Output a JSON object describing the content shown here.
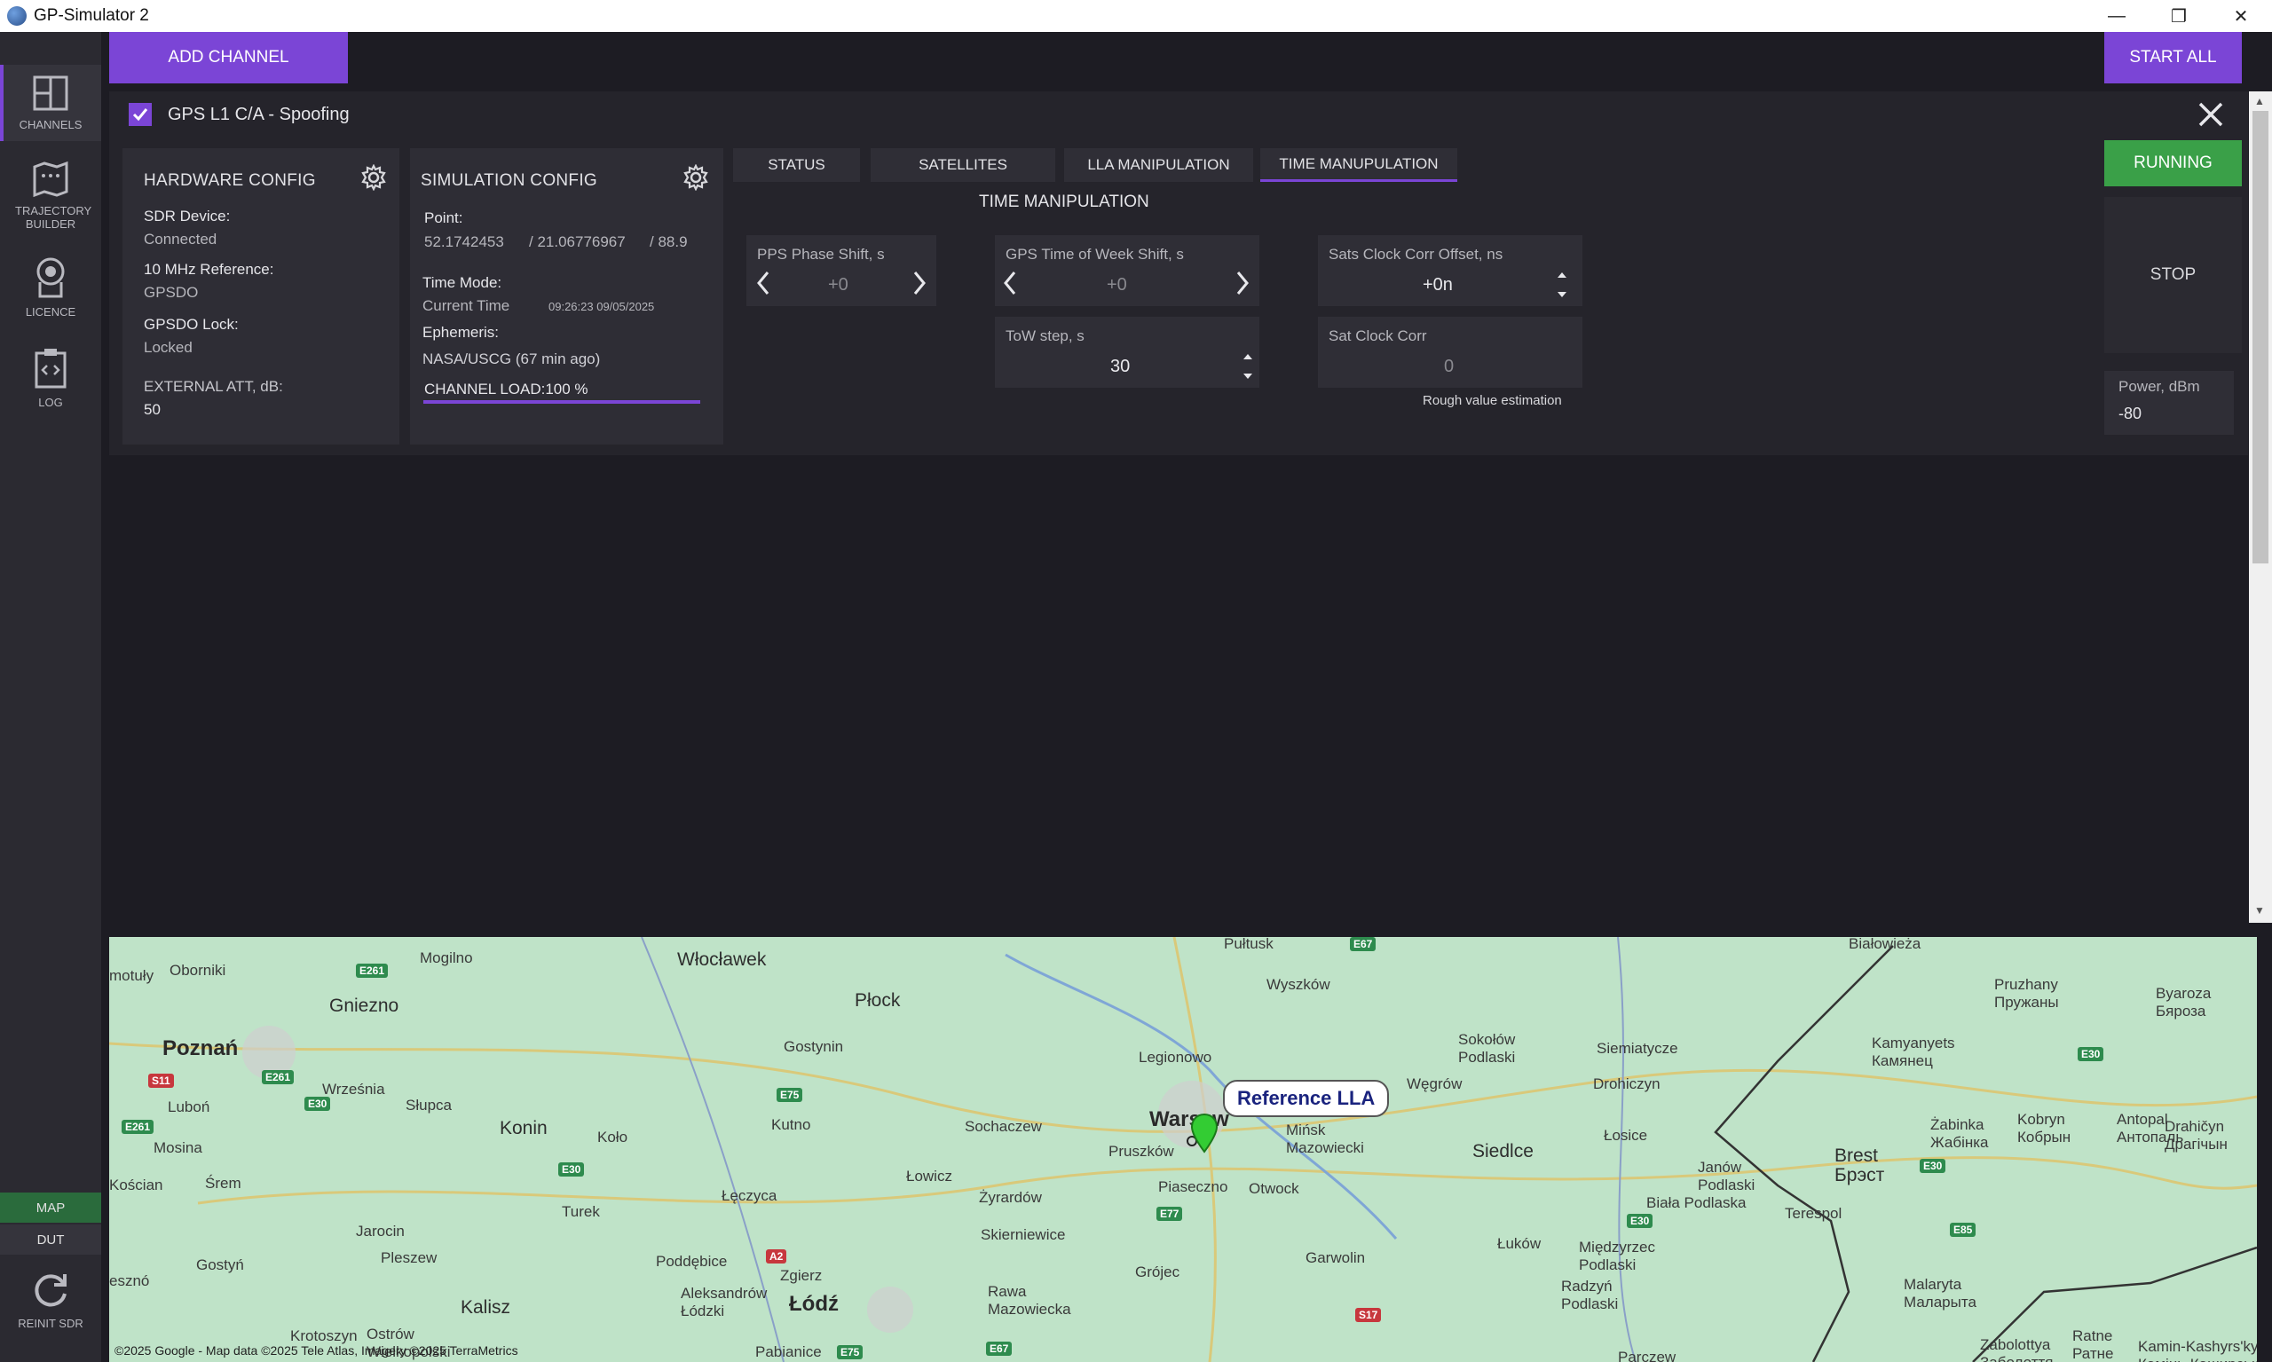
{
  "window": {
    "title": "GP-Simulator 2",
    "minimize": "—",
    "restore": "❐",
    "close": "✕"
  },
  "sidebar": {
    "items": [
      {
        "label": "CHANNELS",
        "icon": "grid-icon"
      },
      {
        "label": "TRAJECTORY BUILDER",
        "icon": "map-route-icon"
      },
      {
        "label": "LICENCE",
        "icon": "badge-icon"
      },
      {
        "label": "LOG",
        "icon": "code-clipboard-icon"
      }
    ],
    "map_label": "MAP",
    "dut_label": "DUT",
    "reinit_label": "REINIT SDR"
  },
  "toolbar": {
    "add_channel": "ADD CHANNEL",
    "start_all": "START ALL"
  },
  "channel": {
    "title": "GPS L1 C/A - Spoofing",
    "checked": true,
    "hardware": {
      "title": "HARDWARE CONFIG",
      "sdr_label": "SDR Device:",
      "sdr_value": "Connected",
      "ref_label": "10 MHz Reference:",
      "ref_value": "GPSDO",
      "lock_label": "GPSDO Lock:",
      "lock_value": "Locked",
      "att_label": "EXTERNAL ATT, dB:",
      "att_value": "50"
    },
    "simulation": {
      "title": "SIMULATION CONFIG",
      "point_label": "Point:",
      "lat": "52.1742453",
      "lon": "/ 21.06776967",
      "alt": "/ 88.9",
      "time_mode_label": "Time Mode:",
      "time_mode_value": "Current Time",
      "time_stamp": "09:26:23  09/05/2025",
      "ephemeris_label": "Ephemeris:",
      "ephemeris_value": "NASA/USCG (67 min ago)",
      "load_label": "CHANNEL LOAD:100  %",
      "load_fraction": 1.0
    },
    "tabs": [
      "STATUS",
      "SATELLITES",
      "LLA MANIPULATION",
      "TIME MANUPULATION"
    ],
    "active_tab": 3,
    "time_manipulation": {
      "heading": "TIME MANIPULATION",
      "pps_label": "PPS Phase Shift, s",
      "pps_value": "+0",
      "gps_tow_label": "GPS Time of Week Shift, s",
      "gps_tow_value": "+0",
      "sats_clock_label": "Sats Clock Corr Offset, ns",
      "sats_clock_value": "+0n",
      "tow_step_label": "ToW step, s",
      "tow_step_value": "30",
      "sat_clock_corr_label": "Sat Clock Corr",
      "sat_clock_corr_value": "0",
      "rough_note": "Rough value estimation"
    },
    "running_label": "RUNNING",
    "stop_label": "STOP",
    "power_label": "Power, dBm",
    "power_value": "-80"
  },
  "map": {
    "callout": "Reference LLA",
    "credits": "©2025 Google - Map data ©2025 Tele Atlas, Imagery ©2025 TerraMetrics",
    "cities": [
      {
        "name": "Poznań",
        "cls": "big"
      },
      {
        "name": "Warsaw",
        "cls": "big"
      },
      {
        "name": "Łódź",
        "cls": "big"
      },
      {
        "name": "Konin",
        "cls": "mid"
      },
      {
        "name": "Płock",
        "cls": "mid"
      },
      {
        "name": "Siedlce",
        "cls": "mid"
      },
      {
        "name": "Brest\nБрэст",
        "cls": "mid"
      },
      {
        "name": "Włocławek",
        "cls": "mid"
      },
      {
        "name": "Gniezno",
        "cls": "mid"
      },
      {
        "name": "Kalisz",
        "cls": "mid"
      },
      {
        "name": "Oborniki",
        "cls": ""
      },
      {
        "name": "Mogilno",
        "cls": ""
      },
      {
        "name": "Pułtusk",
        "cls": ""
      },
      {
        "name": "Wyszków",
        "cls": ""
      },
      {
        "name": "Białowieża",
        "cls": ""
      },
      {
        "name": "Pruzhany\nПружаны",
        "cls": ""
      },
      {
        "name": "Byaroza\nБяроза",
        "cls": ""
      },
      {
        "name": "Września",
        "cls": ""
      },
      {
        "name": "Gostynin",
        "cls": ""
      },
      {
        "name": "Legionowo",
        "cls": ""
      },
      {
        "name": "Sokołów\nPodlaski",
        "cls": ""
      },
      {
        "name": "Siemiatycze",
        "cls": ""
      },
      {
        "name": "Kamyanyets\nКамянец",
        "cls": ""
      },
      {
        "name": "Luboń",
        "cls": ""
      },
      {
        "name": "Słupca",
        "cls": ""
      },
      {
        "name": "Kutno",
        "cls": ""
      },
      {
        "name": "Sochaczew",
        "cls": ""
      },
      {
        "name": "Węgrów",
        "cls": ""
      },
      {
        "name": "Drohiczyn",
        "cls": ""
      },
      {
        "name": "Mosina",
        "cls": ""
      },
      {
        "name": "Koło",
        "cls": ""
      },
      {
        "name": "Pruszków",
        "cls": ""
      },
      {
        "name": "Mińsk\nMazowiecki",
        "cls": ""
      },
      {
        "name": "Łosice",
        "cls": ""
      },
      {
        "name": "Żabinka\nЖабінка",
        "cls": ""
      },
      {
        "name": "Kobryn\nКобрын",
        "cls": ""
      },
      {
        "name": "Antopal\nАнтопаль",
        "cls": ""
      },
      {
        "name": "Drahičyn\nДрагічын",
        "cls": ""
      },
      {
        "name": "Kościan",
        "cls": ""
      },
      {
        "name": "Śrem",
        "cls": ""
      },
      {
        "name": "Łowicz",
        "cls": ""
      },
      {
        "name": "Janów\nPodlaski",
        "cls": ""
      },
      {
        "name": "Turek",
        "cls": ""
      },
      {
        "name": "Łęczyca",
        "cls": ""
      },
      {
        "name": "Żyrardów",
        "cls": ""
      },
      {
        "name": "Piaseczno",
        "cls": ""
      },
      {
        "name": "Otwock",
        "cls": ""
      },
      {
        "name": "Biała Podlaska",
        "cls": ""
      },
      {
        "name": "Terespol",
        "cls": ""
      },
      {
        "name": "Jarocin",
        "cls": ""
      },
      {
        "name": "Skierniewice",
        "cls": ""
      },
      {
        "name": "Łuków",
        "cls": ""
      },
      {
        "name": "Międzyrzec\nPodlaski",
        "cls": ""
      },
      {
        "name": "Pleszew",
        "cls": ""
      },
      {
        "name": "Poddębice",
        "cls": ""
      },
      {
        "name": "Grójec",
        "cls": ""
      },
      {
        "name": "Garwolin",
        "cls": ""
      },
      {
        "name": "Gostyń",
        "cls": ""
      },
      {
        "name": "Zgierz",
        "cls": ""
      },
      {
        "name": "Aleksandrów\nŁódzki",
        "cls": ""
      },
      {
        "name": "Rawa\nMazowiecka",
        "cls": ""
      },
      {
        "name": "Radzyń\nPodlaski",
        "cls": ""
      },
      {
        "name": "Malaryta\nМаларыта",
        "cls": ""
      },
      {
        "name": "Krotoszyn",
        "cls": ""
      },
      {
        "name": "Ostrów\nWielkopolski",
        "cls": ""
      },
      {
        "name": "Pabianice",
        "cls": ""
      },
      {
        "name": "Parczew",
        "cls": ""
      },
      {
        "name": "Zabolottya\nЗаболоття",
        "cls": ""
      },
      {
        "name": "Ratne\nРатне",
        "cls": ""
      },
      {
        "name": "Kamin-Kashyrs'kyi\nКамінь-Каширський",
        "cls": ""
      },
      {
        "name": "esznó",
        "cls": ""
      },
      {
        "name": "motuły",
        "cls": ""
      }
    ],
    "roads": [
      {
        "name": "E261",
        "cls": "green"
      },
      {
        "name": "E67",
        "cls": "green"
      },
      {
        "name": "S11",
        "cls": "red"
      },
      {
        "name": "E261",
        "cls": "green"
      },
      {
        "name": "E75",
        "cls": "green"
      },
      {
        "name": "E30",
        "cls": "green"
      },
      {
        "name": "E261",
        "cls": "green"
      },
      {
        "name": "E30",
        "cls": "green"
      },
      {
        "name": "E30",
        "cls": "green"
      },
      {
        "name": "E30",
        "cls": "green"
      },
      {
        "name": "E30",
        "cls": "green"
      },
      {
        "name": "E77",
        "cls": "green"
      },
      {
        "name": "A2",
        "cls": "red"
      },
      {
        "name": "E85",
        "cls": "green"
      },
      {
        "name": "S17",
        "cls": "red"
      },
      {
        "name": "E75",
        "cls": "green"
      },
      {
        "name": "E67",
        "cls": "green"
      }
    ]
  }
}
